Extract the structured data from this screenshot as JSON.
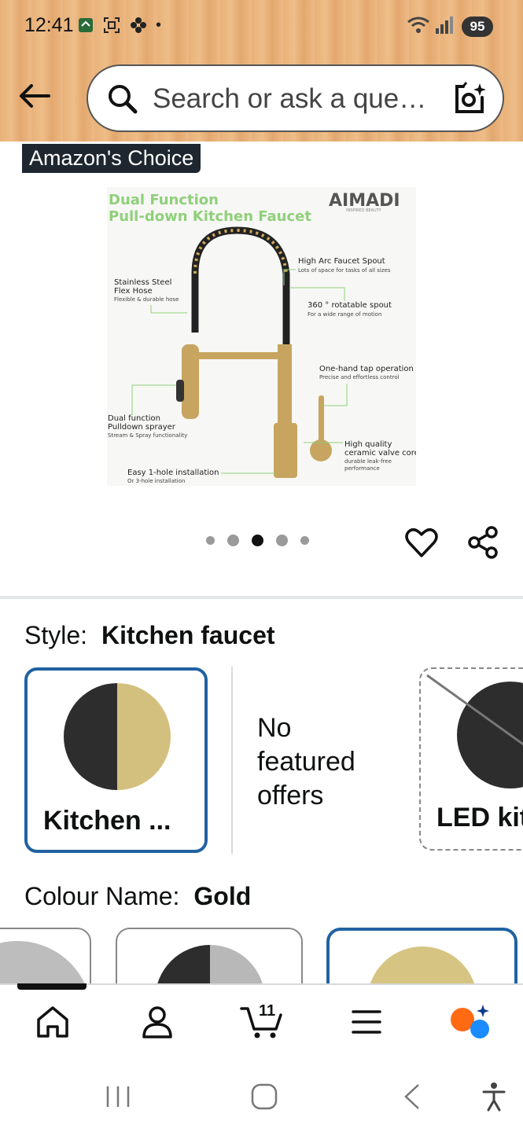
{
  "status_bar": {
    "time": "12:41",
    "battery": "95"
  },
  "search": {
    "placeholder": "Search or ask a question"
  },
  "product": {
    "badge": "Amazon's Choice",
    "image_texts": {
      "headline_1": "Dual Function",
      "headline_2": "Pull-down Kitchen Faucet",
      "brand": "AIMADI",
      "brand_tag": "INSPIRED BEAUTY",
      "f1_title": "High Arc Faucet Spout",
      "f1_sub": "Lots of space for tasks of all sizes",
      "f2_title": "Stainless Steel",
      "f2_title2": "Flex Hose",
      "f2_sub": "Flexible & durable hose",
      "f3_title": "360 ° rotatable spout",
      "f3_sub": "For a wide range of motion",
      "f4_title": "One-hand tap operation",
      "f4_sub": "Precise and effortless control",
      "f5_title": "Dual function",
      "f5_title2": "Pulldown sprayer",
      "f5_sub": "Stream & Spray functionality",
      "f6_title": "High quality",
      "f6_title2": "ceramic valve core",
      "f6_sub": "durable leak-free",
      "f6_sub2": "performance",
      "f7_title": "Easy 1-hole installation",
      "f7_sub": "Or 3-hole installation"
    },
    "carousel": {
      "count": 5,
      "active_index": 2
    }
  },
  "style": {
    "label": "Style:",
    "selected": "Kitchen faucet",
    "options": [
      {
        "label": "Kitchen ..."
      },
      {
        "label": "No featured offers"
      },
      {
        "label": "LED kit"
      }
    ]
  },
  "colour": {
    "label": "Colour Name:",
    "selected": "Gold"
  },
  "bottom_nav": {
    "cart_count": "11"
  },
  "colors": {
    "selected_border": "#2162a1",
    "header_bg": "#e8b27a",
    "gold": "#cbb26a"
  }
}
